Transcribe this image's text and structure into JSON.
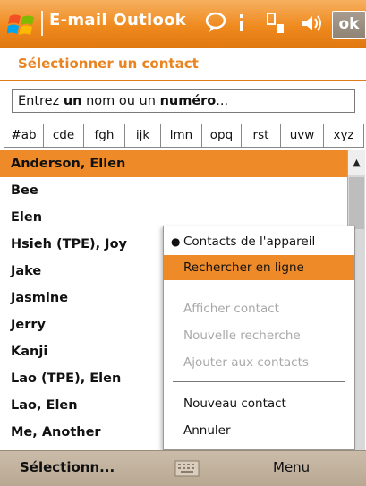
{
  "titlebar": {
    "title": "E-mail Outlook",
    "ok_label": "ok",
    "icons": [
      "windows-start-icon",
      "chat-icon",
      "signal-icon",
      "connectivity-icon",
      "volume-icon"
    ],
    "color": "#ef8a1e"
  },
  "subtitle": "Sélectionner un contact",
  "search": {
    "text_parts": [
      "Entrez ",
      "un",
      " nom ou un ",
      "numéro",
      "..."
    ]
  },
  "tabs": [
    "#ab",
    "cde",
    "fgh",
    "ijk",
    "lmn",
    "opq",
    "rst",
    "uvw",
    "xyz"
  ],
  "contacts": [
    "Anderson, Ellen",
    "Bee",
    "Elen",
    "Hsieh (TPE), Joy",
    "Jake",
    "Jasmine",
    "Jerry",
    "Kanji",
    "Lao (TPE), Elen",
    "Lao, Elen",
    "Me, Another"
  ],
  "selected_contact": "Anderson, Ellen",
  "menu": {
    "items": [
      {
        "label": "Contacts de l'appareil",
        "state": "checked"
      },
      {
        "label": "Rechercher en ligne",
        "state": "highlighted"
      },
      {
        "label": "Afficher contact",
        "state": "disabled"
      },
      {
        "label": "Nouvelle recherche",
        "state": "disabled"
      },
      {
        "label": "Ajouter aux contacts",
        "state": "disabled"
      },
      {
        "label": "Nouveau contact",
        "state": "normal"
      },
      {
        "label": "Annuler",
        "state": "normal"
      }
    ],
    "highlight_color": "#ee8a28"
  },
  "softkeys": {
    "left": "Sélectionn...",
    "right": "Menu"
  }
}
